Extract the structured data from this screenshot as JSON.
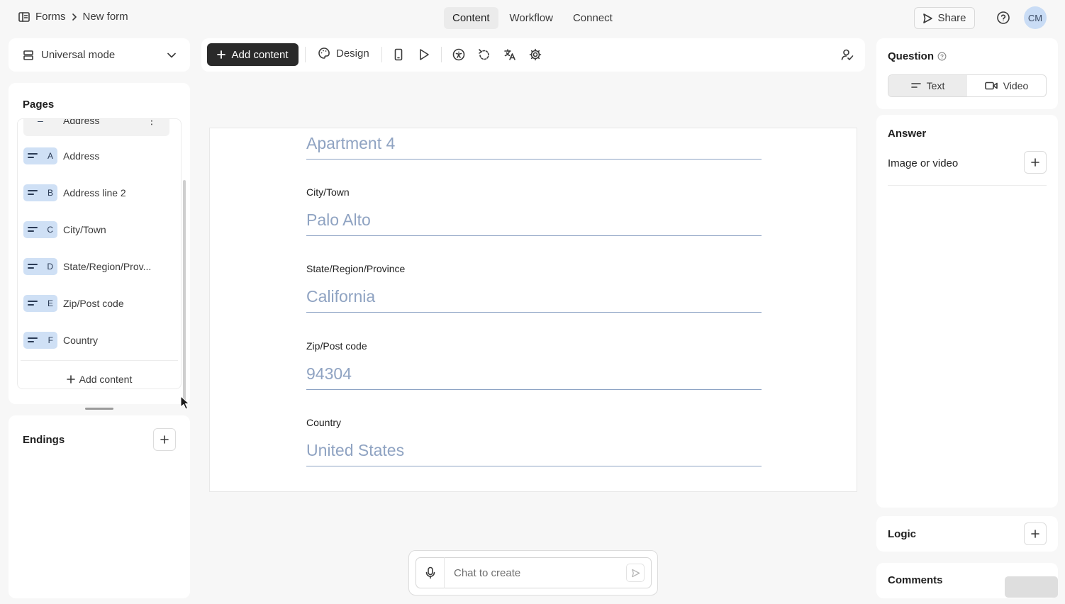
{
  "breadcrumb": {
    "root": "Forms",
    "current": "New form"
  },
  "top_tabs": [
    {
      "label": "Content",
      "active": true
    },
    {
      "label": "Workflow",
      "active": false
    },
    {
      "label": "Connect",
      "active": false
    }
  ],
  "header": {
    "share_label": "Share",
    "avatar_initials": "CM"
  },
  "sidebar": {
    "mode_label": "Universal mode",
    "pages_title": "Pages",
    "partial_item": {
      "label": "Address"
    },
    "items": [
      {
        "letter": "A",
        "label": "Address"
      },
      {
        "letter": "B",
        "label": "Address line 2"
      },
      {
        "letter": "C",
        "label": "City/Town"
      },
      {
        "letter": "D",
        "label": "State/Region/Prov..."
      },
      {
        "letter": "E",
        "label": "Zip/Post code"
      },
      {
        "letter": "F",
        "label": "Country"
      }
    ],
    "add_content_label": "Add content",
    "endings_title": "Endings"
  },
  "toolbar": {
    "add_content_label": "Add content",
    "design_label": "Design"
  },
  "form": {
    "fields": [
      {
        "label": "",
        "placeholder": "Apartment 4"
      },
      {
        "label": "City/Town",
        "placeholder": "Palo Alto"
      },
      {
        "label": "State/Region/Province",
        "placeholder": "California"
      },
      {
        "label": "Zip/Post code",
        "placeholder": "94304"
      },
      {
        "label": "Country",
        "placeholder": "United States"
      }
    ]
  },
  "chat": {
    "placeholder": "Chat to create"
  },
  "right_panel": {
    "question_title": "Question",
    "question_types": [
      {
        "label": "Text",
        "active": true
      },
      {
        "label": "Video",
        "active": false
      }
    ],
    "answer_title": "Answer",
    "image_or_video_label": "Image or video",
    "logic_title": "Logic",
    "comments_title": "Comments"
  },
  "colors": {
    "accent_badge": "#cfe0f5",
    "input_text": "#8fa3c2",
    "primary_button": "#2a2a2a"
  }
}
